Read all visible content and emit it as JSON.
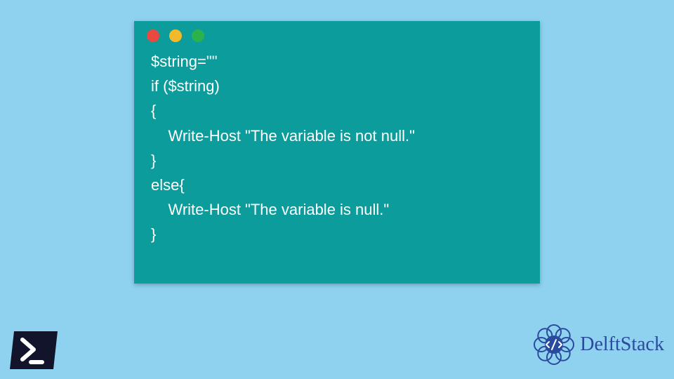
{
  "code": {
    "lines": [
      "$string=\"\"",
      "if ($string)",
      "{",
      "    Write-Host \"The variable is not null.\"",
      "}",
      "else{",
      "    Write-Host \"The variable is null.\"",
      "}"
    ]
  },
  "brand": {
    "name": "DelftStack"
  }
}
